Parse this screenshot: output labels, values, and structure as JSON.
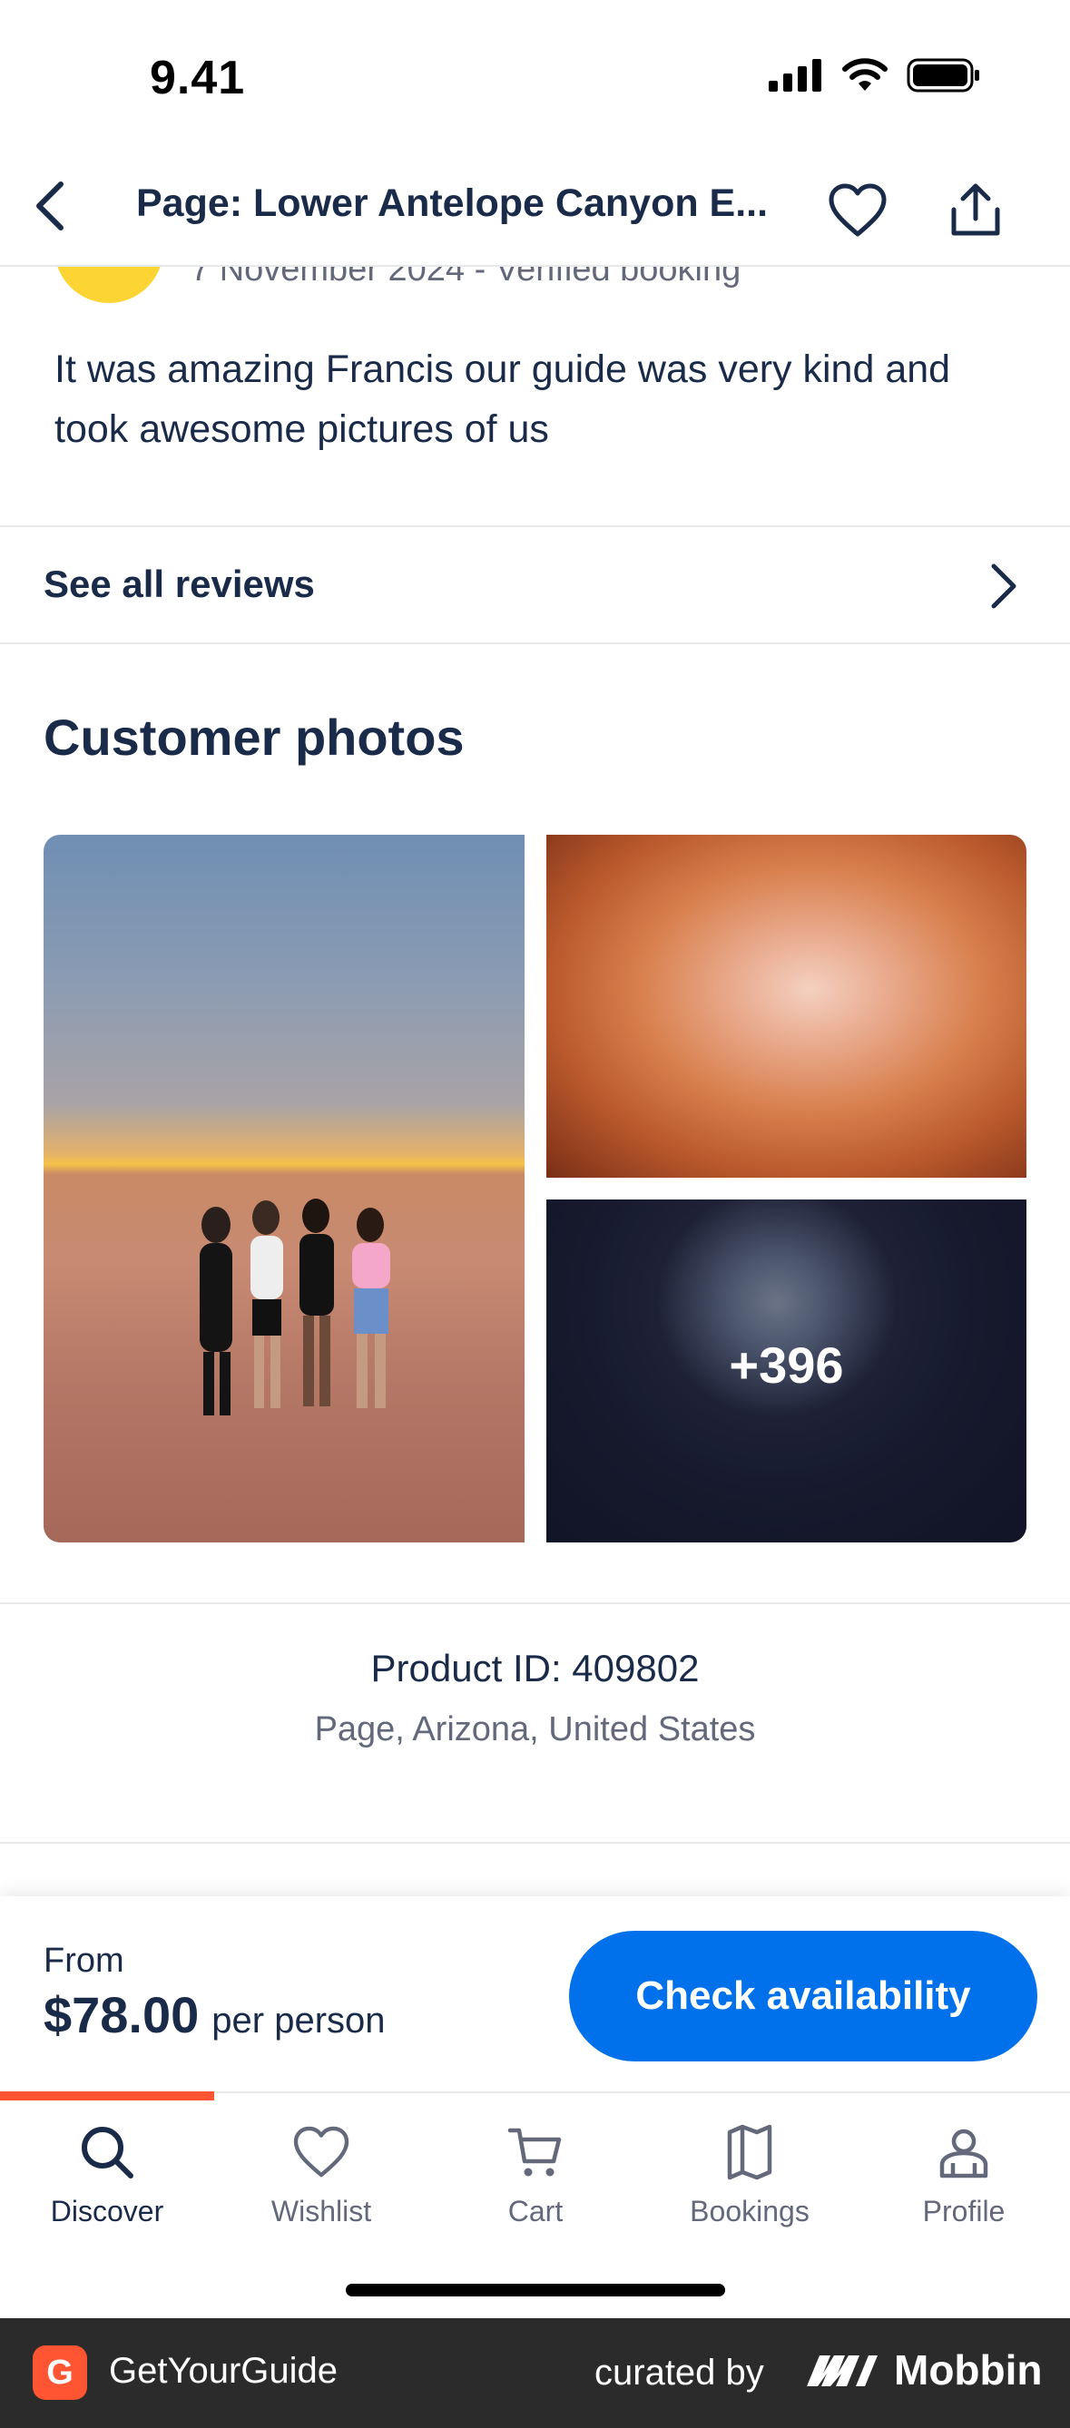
{
  "status_bar": {
    "time": "9.41"
  },
  "header": {
    "title": "Page: Lower Antelope Canyon E..."
  },
  "review": {
    "meta": "7 November 2024 - Verified booking",
    "text": "It was amazing Francis our guide was very kind and took awesome pictures of us"
  },
  "see_all": {
    "label": "See all reviews"
  },
  "customer_photos": {
    "title": "Customer photos",
    "more_count": "+396"
  },
  "product": {
    "id_text": "Product ID: 409802",
    "location": "Page, Arizona, United States"
  },
  "booking": {
    "from_label": "From",
    "price": "$78.00",
    "per_person": "per person",
    "button_label": "Check availability",
    "accent_color": "#0071eb"
  },
  "tabs": [
    {
      "label": "Discover",
      "icon": "search-icon",
      "active": true
    },
    {
      "label": "Wishlist",
      "icon": "heart-icon",
      "active": false
    },
    {
      "label": "Cart",
      "icon": "cart-icon",
      "active": false
    },
    {
      "label": "Bookings",
      "icon": "bookmark-map-icon",
      "active": false
    },
    {
      "label": "Profile",
      "icon": "profile-icon",
      "active": false
    }
  ],
  "footer": {
    "app_name": "GetYourGuide",
    "curated_by": "curated by",
    "brand": "Mobbin"
  }
}
